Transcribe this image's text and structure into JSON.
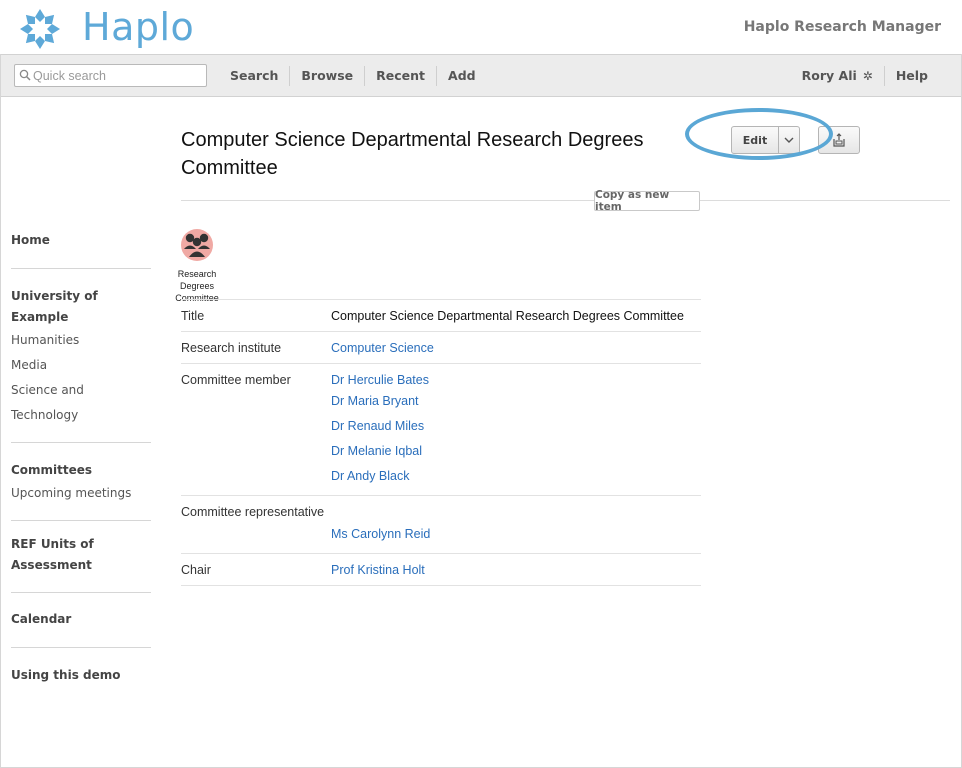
{
  "header": {
    "logo_text": "Haplo",
    "app_name": "Haplo Research Manager"
  },
  "toolbar": {
    "search_placeholder": "Quick search",
    "nav": [
      "Search",
      "Browse",
      "Recent",
      "Add"
    ],
    "user": "Rory Ali",
    "help": "Help"
  },
  "sidebar": {
    "home": "Home",
    "university": "University of Example",
    "university_items": [
      "Humanities",
      "Media",
      "Science and Technology"
    ],
    "committees": "Committees",
    "committees_items": [
      "Upcoming meetings"
    ],
    "ref_line1": "REF Units of",
    "ref_line2": "Assessment",
    "calendar": "Calendar",
    "demo": "Using this demo"
  },
  "page": {
    "title": "Computer Science Departmental Research Degrees Committee",
    "edit_label": "Edit",
    "copy_label": "Copy as new item",
    "type_label_lines": [
      "Research",
      "Degrees",
      "Committee"
    ]
  },
  "attributes": [
    {
      "label": "Title",
      "values": [
        "Computer Science Departmental Research Degrees Committee"
      ]
    },
    {
      "label": "Research institute",
      "values": [
        "Computer Science"
      ]
    },
    {
      "label": "Committee member",
      "values": [
        "Dr Herculie Bates",
        "Dr Maria Bryant",
        "Dr Renaud Miles",
        "Dr Melanie Iqbal",
        "Dr Andy Black"
      ]
    },
    {
      "label": "Committee representative",
      "values": [
        "Ms Carolynn Reid"
      ]
    },
    {
      "label": "Chair",
      "values": [
        "Prof Kristina Holt"
      ]
    }
  ],
  "colors": {
    "brand": "#5ea9d8",
    "link": "#2a6ebb",
    "highlight": "#5aa7d5"
  }
}
